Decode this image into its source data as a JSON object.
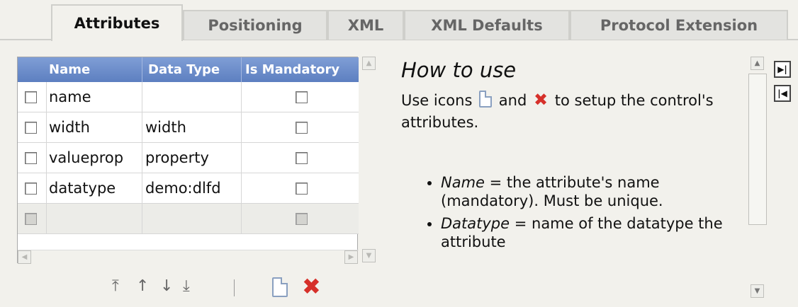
{
  "tabs": [
    "Attributes",
    "Positioning",
    "XML",
    "XML Defaults",
    "Protocol Extension"
  ],
  "grid": {
    "columns": [
      "Name",
      "Data Type",
      "Is Mandatory"
    ],
    "rows": [
      {
        "name": "name",
        "data_type": "",
        "mandatory": false
      },
      {
        "name": "width",
        "data_type": "width",
        "mandatory": false
      },
      {
        "name": "valueprop",
        "data_type": "property",
        "mandatory": false
      },
      {
        "name": "datatype",
        "data_type": "demo:dlfd",
        "mandatory": false
      }
    ]
  },
  "toolbar": {
    "move_top": "⤒",
    "move_up": "↑",
    "move_down": "↓",
    "move_bottom": "⤓",
    "separator": "|"
  },
  "help": {
    "title": "How to use",
    "intro_before": "Use icons",
    "intro_and": "and",
    "intro_after": "to setup the control's attributes.",
    "bullets": [
      {
        "term": "Name",
        "text": " = the attribute's name (mandatory). Must be unique."
      },
      {
        "term": "Datatype",
        "text": " = name of the datatype the attribute"
      }
    ]
  },
  "side_buttons": {
    "expand": "▶|",
    "collapse": "|◀"
  }
}
